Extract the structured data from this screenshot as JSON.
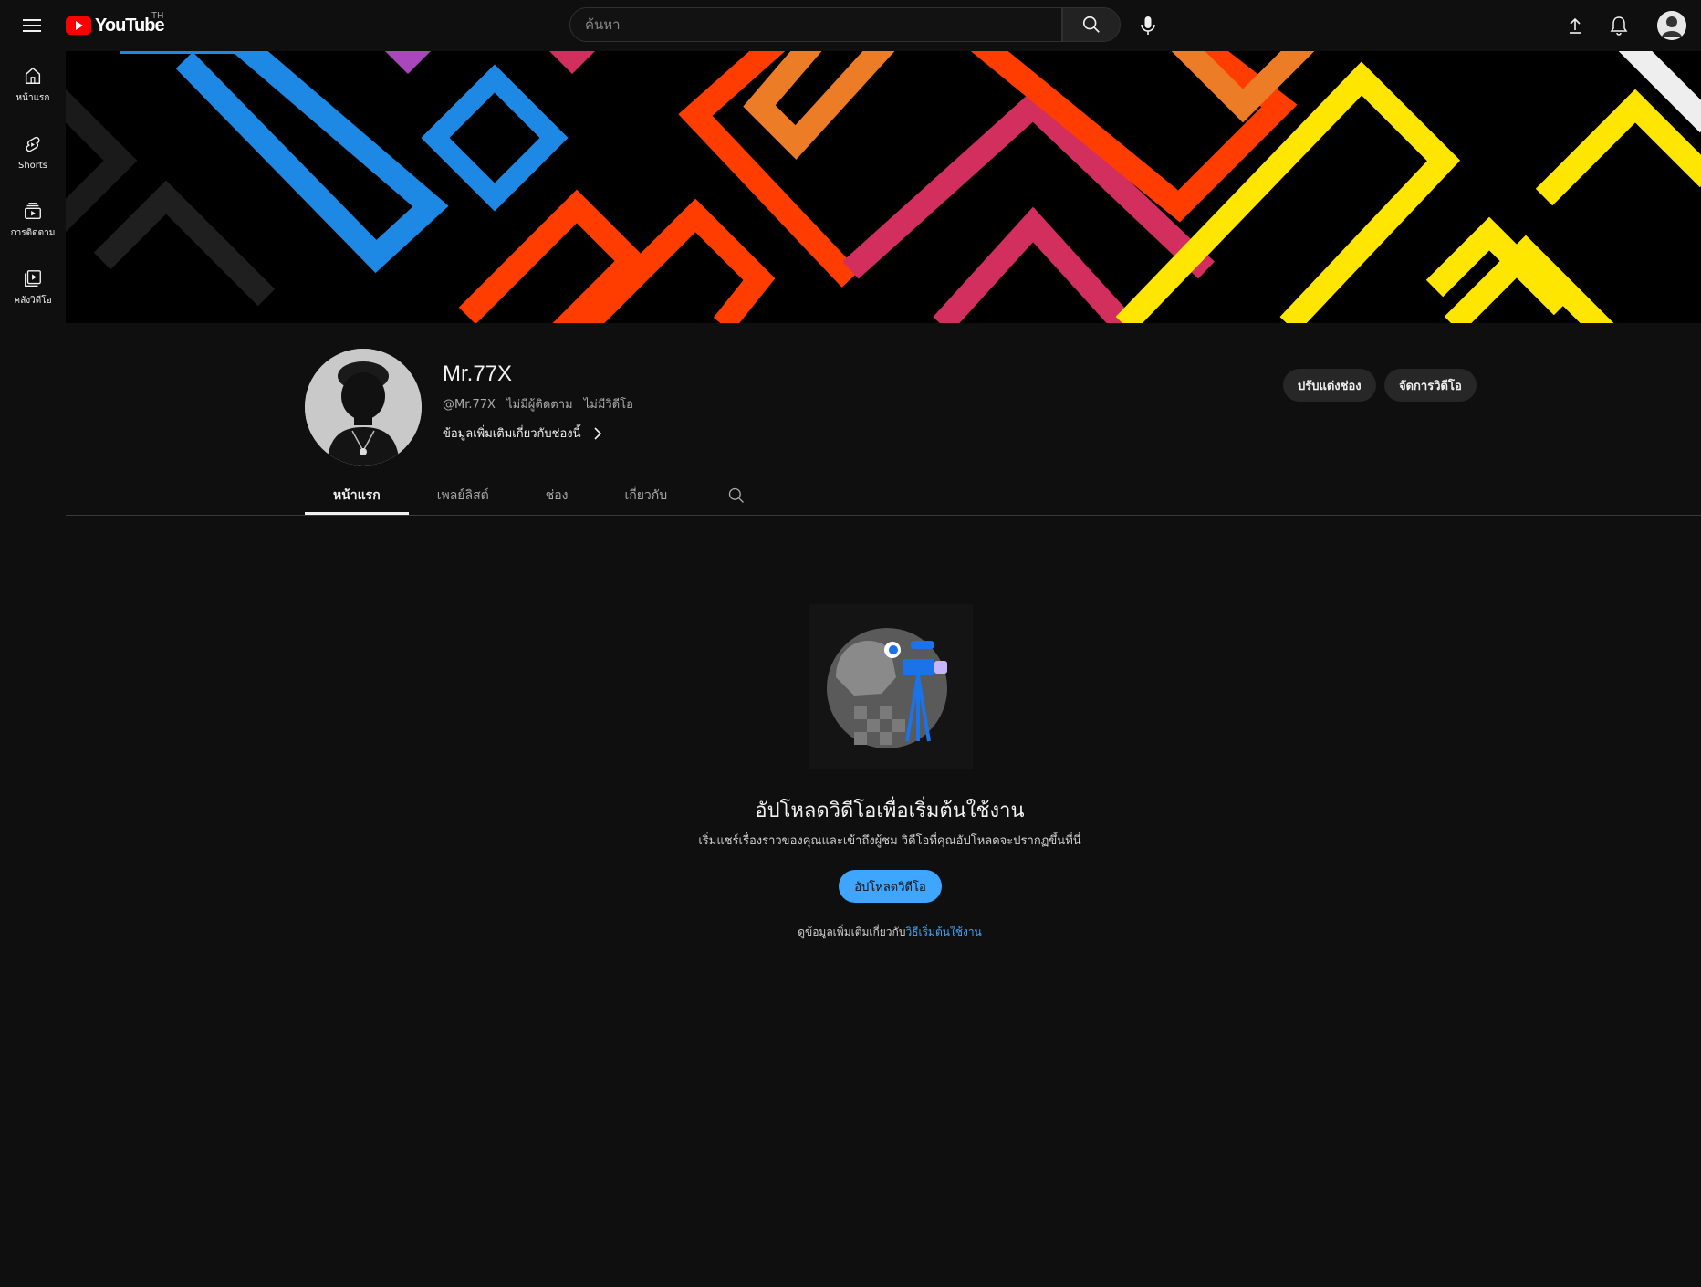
{
  "topbar": {
    "logo_text": "YouTube",
    "region": "TH",
    "search_placeholder": "ค้นหา"
  },
  "sidebar": {
    "items": [
      {
        "label": "หน้าแรก",
        "icon": "home-icon"
      },
      {
        "label": "Shorts",
        "icon": "shorts-icon"
      },
      {
        "label": "การติดตาม",
        "icon": "subscriptions-icon"
      },
      {
        "label": "คลังวิดีโอ",
        "icon": "library-icon"
      }
    ]
  },
  "channel": {
    "name": "Mr.77X",
    "handle": "@Mr.77X",
    "subscribers": "ไม่มีผู้ติดตาม",
    "videos": "ไม่มีวิดีโอ",
    "more_info": "ข้อมูลเพิ่มเติมเกี่ยวกับช่องนี้",
    "customize_label": "ปรับแต่งช่อง",
    "manage_label": "จัดการวิดีโอ"
  },
  "tabs": [
    "หน้าแรก",
    "เพลย์ลิสต์",
    "ช่อง",
    "เกี่ยวกับ"
  ],
  "empty_state": {
    "title": "อัปโหลดวิดีโอเพื่อเริ่มต้นใช้งาน",
    "subtitle": "เริ่มแชร์เรื่องราวของคุณและเข้าถึงผู้ชม วิดีโอที่คุณอัปโหลดจะปรากฏขึ้นที่นี่",
    "button": "อัปโหลดวิดีโอ",
    "learn_prefix": "ดูข้อมูลเพิ่มเติมเกี่ยวกับ",
    "learn_link": "วิธีเริ่มต้นใช้งาน"
  },
  "colors": {
    "background": "#0f0f0f",
    "accent": "#3ea6ff",
    "brand_red": "#ff0000"
  }
}
